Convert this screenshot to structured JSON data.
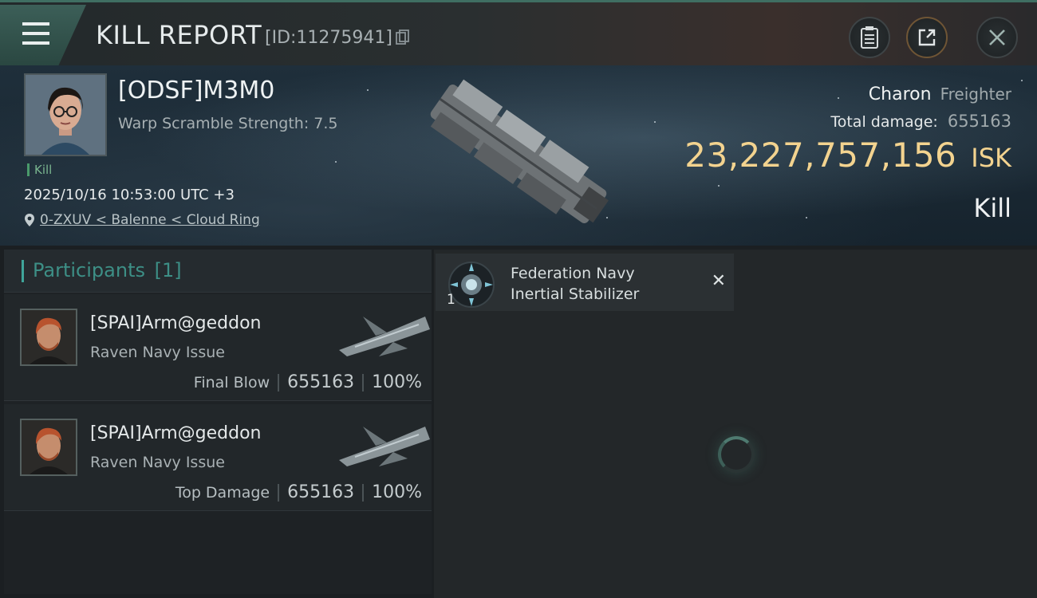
{
  "header": {
    "title": "KILL REPORT",
    "report_id": "[ID:11275941]",
    "icons": {
      "menu": "hamburger-icon",
      "copy": "copy-icon",
      "clipboard": "clipboard-icon",
      "share": "share-icon",
      "close": "close-icon"
    }
  },
  "victim": {
    "name": "[ODSF]M3M0",
    "warp_scramble": "Warp Scramble Strength: 7.5",
    "kill_tag": "Kill",
    "datetime": "2025/10/16 10:53:00 UTC +3",
    "location": "0-ZXUV < Balenne < Cloud Ring",
    "ship_name": "Charon",
    "ship_class": "Freighter",
    "total_damage_label": "Total damage:",
    "total_damage": "655163",
    "isk_value": "23,227,757,156",
    "isk_unit": "ISK",
    "result": "Kill"
  },
  "participants": {
    "label": "Participants",
    "count": "[1]",
    "cards": [
      {
        "name": "[SPAI]Arm@geddon",
        "ship": "Raven Navy Issue",
        "role": "Final Blow",
        "damage": "655163",
        "percent": "100%"
      },
      {
        "name": "[SPAI]Arm@geddon",
        "ship": "Raven Navy Issue",
        "role": "Top Damage",
        "damage": "655163",
        "percent": "100%"
      }
    ]
  },
  "items": [
    {
      "name_line1": "Federation Navy",
      "name_line2": "Inertial Stabilizer",
      "quantity": "1",
      "status_icon": "destroyed-x-icon"
    }
  ],
  "colors": {
    "accent": "#3fa59a",
    "isk": "#f3d38f",
    "kill_tag": "#4a9a6b"
  }
}
